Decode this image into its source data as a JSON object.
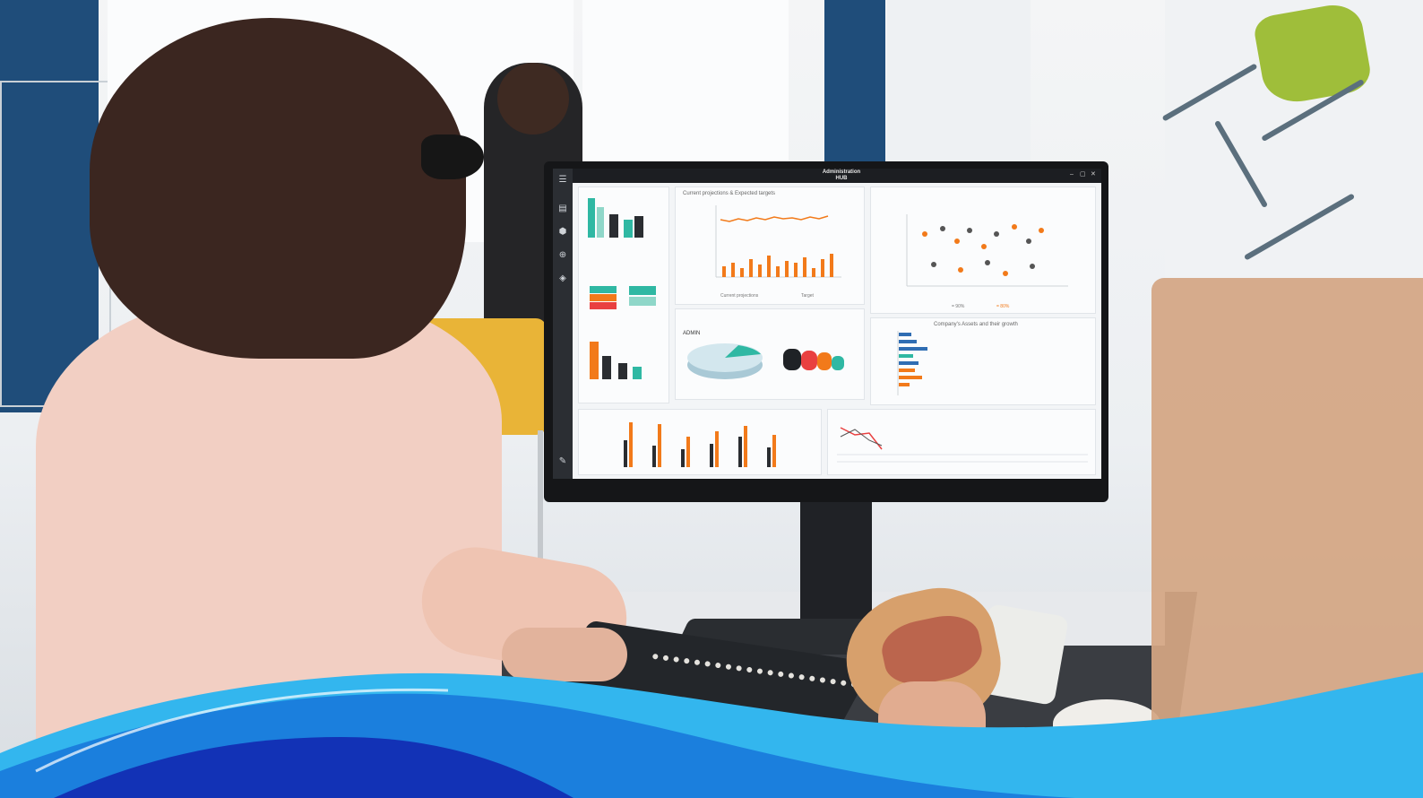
{
  "monitor_app": {
    "title": "Administration",
    "subtitle": "HUB",
    "window_controls": [
      "–",
      "▢",
      "✕"
    ],
    "sidebar_icons": [
      "menu-icon",
      "list-icon",
      "cube-icon",
      "globe-icon",
      "location-icon",
      "edit-icon"
    ],
    "panels": {
      "projections": {
        "title": "Current projections & Expected targets",
        "legend": [
          "Current projections",
          "Target"
        ]
      },
      "scatter": {
        "legend": [
          "= 90%",
          "= 80%"
        ]
      },
      "small_legend": [
        "ADMIN"
      ],
      "bars_title": "Company's Assets and their growth"
    }
  },
  "colors": {
    "accent_orange": "#f27a1a",
    "accent_teal": "#2fb8a3",
    "accent_blue": "#2f6db3",
    "wave_light": "#33b6ee",
    "wave_mid": "#1b7fdd",
    "wave_dark": "#1232b6"
  }
}
